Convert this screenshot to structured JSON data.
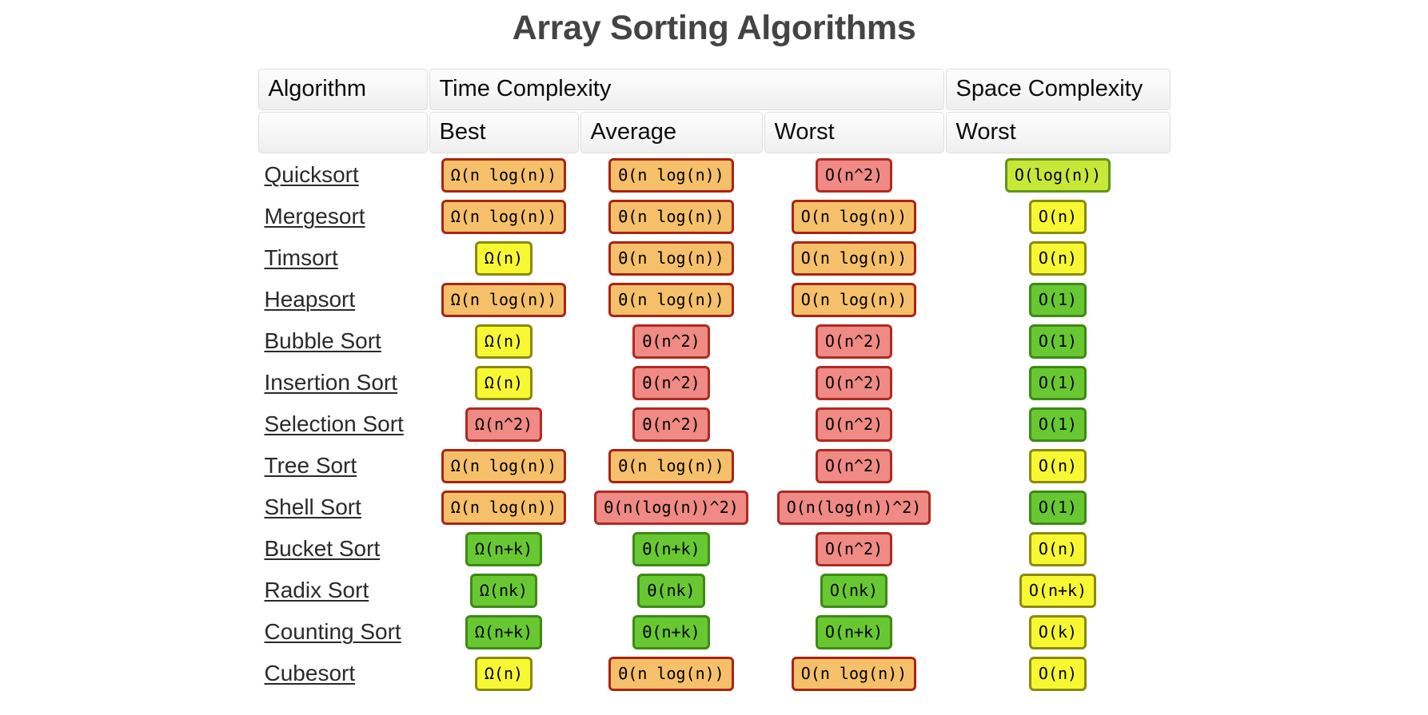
{
  "page": {
    "title": "Array Sorting Algorithms"
  },
  "table": {
    "group_headers": [
      {
        "label": "Algorithm",
        "key": "algorithm"
      },
      {
        "label": "Time Complexity",
        "key": "time"
      },
      {
        "label": "Space Complexity",
        "key": "space"
      }
    ],
    "sub_headers": [
      {
        "label": "",
        "key": "blank"
      },
      {
        "label": "Best",
        "key": "best"
      },
      {
        "label": "Average",
        "key": "average"
      },
      {
        "label": "Worst",
        "key": "worst"
      },
      {
        "label": "Worst",
        "key": "space_worst"
      }
    ],
    "rows": [
      {
        "name": "Quicksort",
        "best": {
          "text": "Ω(n log(n))",
          "color": "orange"
        },
        "avg": {
          "text": "Θ(n log(n))",
          "color": "orange"
        },
        "worst": {
          "text": "O(n^2)",
          "color": "red"
        },
        "space": {
          "text": "O(log(n))",
          "color": "ygreen"
        }
      },
      {
        "name": "Mergesort",
        "best": {
          "text": "Ω(n log(n))",
          "color": "orange"
        },
        "avg": {
          "text": "Θ(n log(n))",
          "color": "orange"
        },
        "worst": {
          "text": "O(n log(n))",
          "color": "orange"
        },
        "space": {
          "text": "O(n)",
          "color": "yellow"
        }
      },
      {
        "name": "Timsort",
        "best": {
          "text": "Ω(n)",
          "color": "yellow"
        },
        "avg": {
          "text": "Θ(n log(n))",
          "color": "orange"
        },
        "worst": {
          "text": "O(n log(n))",
          "color": "orange"
        },
        "space": {
          "text": "O(n)",
          "color": "yellow"
        }
      },
      {
        "name": "Heapsort",
        "best": {
          "text": "Ω(n log(n))",
          "color": "orange"
        },
        "avg": {
          "text": "Θ(n log(n))",
          "color": "orange"
        },
        "worst": {
          "text": "O(n log(n))",
          "color": "orange"
        },
        "space": {
          "text": "O(1)",
          "color": "green"
        }
      },
      {
        "name": "Bubble Sort",
        "best": {
          "text": "Ω(n)",
          "color": "yellow"
        },
        "avg": {
          "text": "Θ(n^2)",
          "color": "red"
        },
        "worst": {
          "text": "O(n^2)",
          "color": "red"
        },
        "space": {
          "text": "O(1)",
          "color": "green"
        }
      },
      {
        "name": "Insertion Sort",
        "best": {
          "text": "Ω(n)",
          "color": "yellow"
        },
        "avg": {
          "text": "Θ(n^2)",
          "color": "red"
        },
        "worst": {
          "text": "O(n^2)",
          "color": "red"
        },
        "space": {
          "text": "O(1)",
          "color": "green"
        }
      },
      {
        "name": "Selection Sort",
        "best": {
          "text": "Ω(n^2)",
          "color": "red"
        },
        "avg": {
          "text": "Θ(n^2)",
          "color": "red"
        },
        "worst": {
          "text": "O(n^2)",
          "color": "red"
        },
        "space": {
          "text": "O(1)",
          "color": "green"
        }
      },
      {
        "name": "Tree Sort",
        "best": {
          "text": "Ω(n log(n))",
          "color": "orange"
        },
        "avg": {
          "text": "Θ(n log(n))",
          "color": "orange"
        },
        "worst": {
          "text": "O(n^2)",
          "color": "red"
        },
        "space": {
          "text": "O(n)",
          "color": "yellow"
        }
      },
      {
        "name": "Shell Sort",
        "best": {
          "text": "Ω(n log(n))",
          "color": "orange"
        },
        "avg": {
          "text": "Θ(n(log(n))^2)",
          "color": "red"
        },
        "worst": {
          "text": "O(n(log(n))^2)",
          "color": "red"
        },
        "space": {
          "text": "O(1)",
          "color": "green"
        }
      },
      {
        "name": "Bucket Sort",
        "best": {
          "text": "Ω(n+k)",
          "color": "green"
        },
        "avg": {
          "text": "Θ(n+k)",
          "color": "green"
        },
        "worst": {
          "text": "O(n^2)",
          "color": "red"
        },
        "space": {
          "text": "O(n)",
          "color": "yellow"
        }
      },
      {
        "name": "Radix Sort",
        "best": {
          "text": "Ω(nk)",
          "color": "green"
        },
        "avg": {
          "text": "Θ(nk)",
          "color": "green"
        },
        "worst": {
          "text": "O(nk)",
          "color": "green"
        },
        "space": {
          "text": "O(n+k)",
          "color": "yellow"
        }
      },
      {
        "name": "Counting Sort",
        "best": {
          "text": "Ω(n+k)",
          "color": "green"
        },
        "avg": {
          "text": "Θ(n+k)",
          "color": "green"
        },
        "worst": {
          "text": "O(n+k)",
          "color": "green"
        },
        "space": {
          "text": "O(k)",
          "color": "yellow"
        }
      },
      {
        "name": "Cubesort",
        "best": {
          "text": "Ω(n)",
          "color": "yellow"
        },
        "avg": {
          "text": "Θ(n log(n))",
          "color": "orange"
        },
        "worst": {
          "text": "O(n log(n))",
          "color": "orange"
        },
        "space": {
          "text": "O(n)",
          "color": "yellow"
        }
      }
    ]
  },
  "legend_colors": {
    "green": "#68c832",
    "yellow_green": "#c8e838",
    "yellow": "#f8f832",
    "orange": "#f5c069",
    "red": "#ef8a84",
    "title_color": "#444444"
  }
}
